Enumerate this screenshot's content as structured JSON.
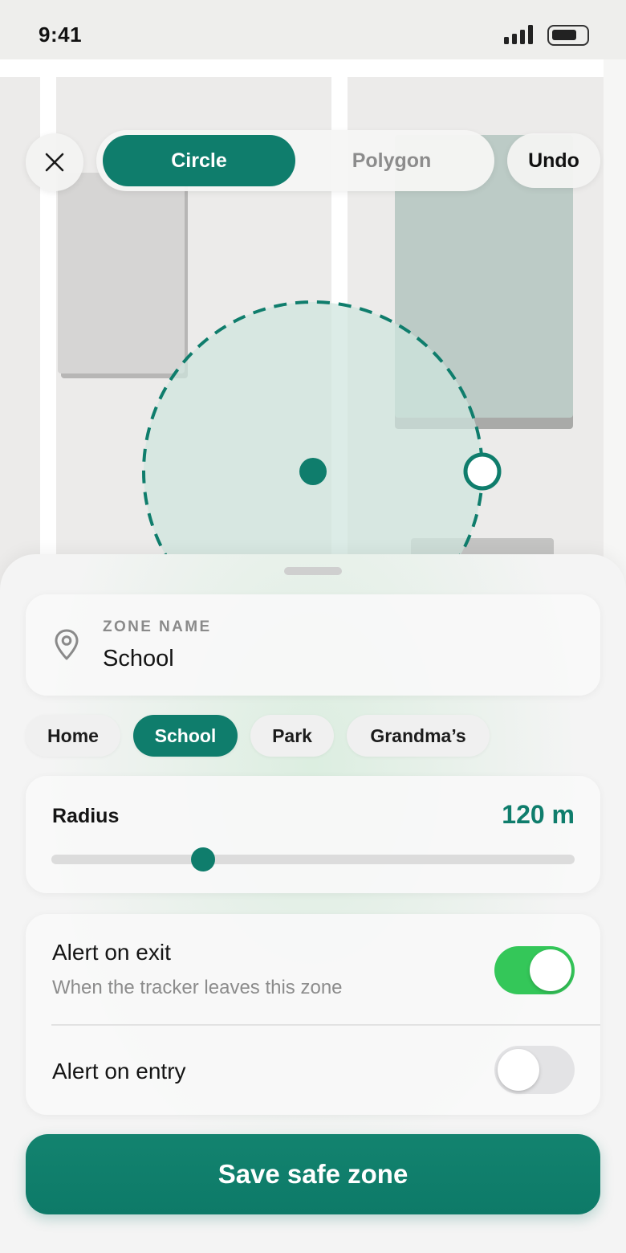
{
  "status_bar": {
    "time": "9:41"
  },
  "mode_switch": {
    "options": [
      "Circle",
      "Polygon"
    ],
    "selected": "Circle"
  },
  "toolbar": {
    "undo_label": "Undo",
    "close_icon": "close-icon"
  },
  "zone_name": {
    "label": "ZONE NAME",
    "value": "School",
    "icon": "map-pin-icon"
  },
  "presets": {
    "items": [
      "Home",
      "School",
      "Park",
      "Grandma’s"
    ],
    "selected": "School"
  },
  "radius": {
    "label": "Radius",
    "value_text": "120 m",
    "slider_fraction": 0.29
  },
  "alerts": {
    "exit": {
      "title": "Alert on exit",
      "subtitle": "When the tracker leaves this zone",
      "enabled": true
    },
    "entry": {
      "title": "Alert on entry",
      "enabled": false
    }
  },
  "save_label": "Save safe zone",
  "colors": {
    "accent": "#0f7d6c",
    "toggle_on": "#34c759",
    "zone_fill": "#cfe4de"
  }
}
